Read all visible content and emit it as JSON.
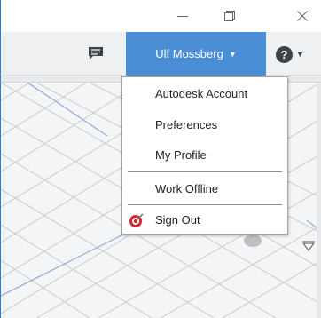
{
  "window": {
    "minimize_icon": "minimize-icon",
    "restore_icon": "restore-icon",
    "close_icon": "close-icon"
  },
  "toolbar": {
    "chat_icon": "comment-icon",
    "user_name": "Ulf Mossberg",
    "user_caret": "▼",
    "help_label": "?",
    "help_caret": "▼"
  },
  "menu": {
    "items": [
      {
        "label": "Autodesk Account"
      },
      {
        "label": "Preferences"
      },
      {
        "label": "My Profile"
      },
      {
        "label": "Work Offline"
      },
      {
        "label": "Sign Out",
        "icon": "sign-out-icon"
      }
    ]
  },
  "colors": {
    "accent": "#4a8fd6",
    "window_border": "#2b7bd1",
    "signout_red": "#d9262f"
  }
}
